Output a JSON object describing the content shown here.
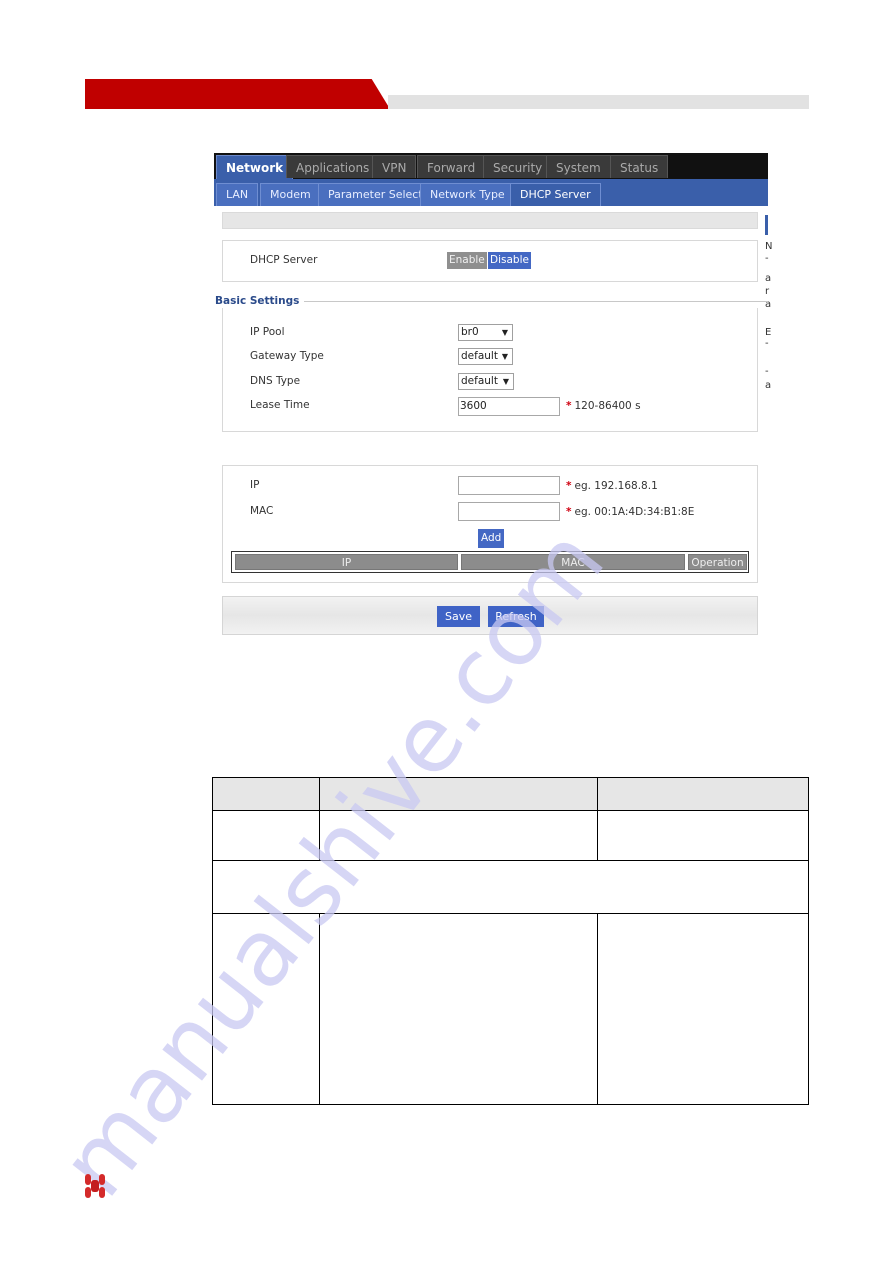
{
  "header": {
    "brand_color": "#c00000",
    "band_color": "#e2e2e2"
  },
  "router_ui": {
    "top_tabs": [
      {
        "label": "Network",
        "active": true
      },
      {
        "label": "Applications",
        "active": false
      },
      {
        "label": "VPN",
        "active": false
      },
      {
        "label": "Forward",
        "active": false
      },
      {
        "label": "Security",
        "active": false
      },
      {
        "label": "System",
        "active": false
      },
      {
        "label": "Status",
        "active": false
      }
    ],
    "sub_tabs": [
      {
        "label": "LAN",
        "active": false
      },
      {
        "label": "Modem",
        "active": false
      },
      {
        "label": "Parameter Select",
        "active": false
      },
      {
        "label": "Network Type",
        "active": false
      },
      {
        "label": "DHCP Server",
        "active": true
      }
    ],
    "dhcp_server": {
      "label": "DHCP Server",
      "enable_label": "Enable",
      "disable_label": "Disable",
      "selected": "Disable"
    },
    "basic_settings": {
      "legend": "Basic Settings",
      "ip_pool": {
        "label": "IP Pool",
        "value": "br0"
      },
      "gateway_type": {
        "label": "Gateway Type",
        "value": "default"
      },
      "dns_type": {
        "label": "DNS Type",
        "value": "default"
      },
      "lease_time": {
        "label": "Lease Time",
        "value": "3600",
        "hint": "120-86400 s"
      }
    },
    "static_binding": {
      "ip": {
        "label": "IP",
        "value": "",
        "hint": "eg. 192.168.8.1"
      },
      "mac": {
        "label": "MAC",
        "value": "",
        "hint": "eg. 00:1A:4D:34:B1:8E"
      },
      "add_label": "Add",
      "required_mark": "*",
      "columns": [
        "IP",
        "MAC",
        "Operation"
      ],
      "rows": []
    },
    "actions": {
      "save_label": "Save",
      "refresh_label": "Refresh"
    },
    "colors": {
      "accent": "#3a5faa",
      "button_blue": "#4468c4",
      "button_gray": "#8f8f8f"
    },
    "cut_off_right_letters": [
      "N",
      "-",
      "a",
      "r",
      "a",
      "E",
      "-",
      "-",
      "a"
    ]
  },
  "doc_table": {
    "header": [
      "",
      "",
      ""
    ],
    "row1": [
      "",
      "",
      ""
    ],
    "spanning_row": "",
    "row2": [
      "",
      "",
      ""
    ]
  },
  "watermark": "manualshive.com",
  "footer": {
    "logo_icon": "brand-logo-icon"
  }
}
